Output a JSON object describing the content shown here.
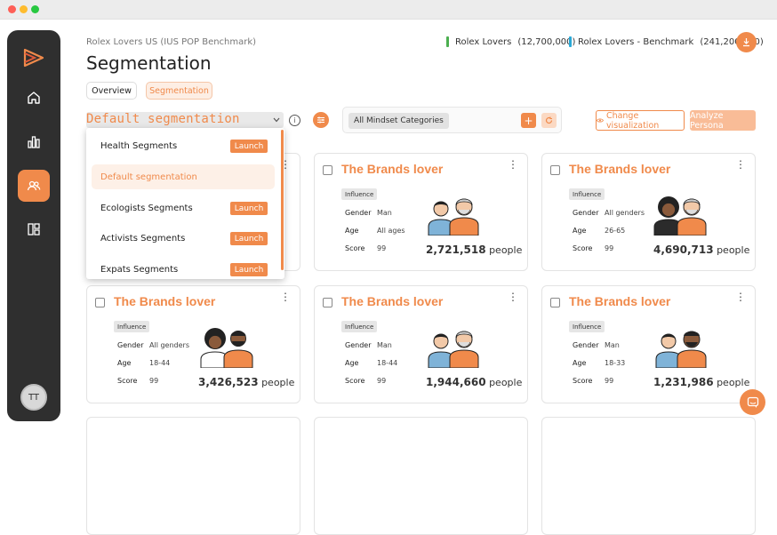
{
  "header": {
    "breadcrumb": "Rolex Lovers US (IUS POP Benchmark)",
    "title": "Segmentation",
    "tabs": [
      {
        "label": "Overview",
        "active": false
      },
      {
        "label": "Segmentation",
        "active": true
      }
    ],
    "legend": [
      {
        "name": "Rolex Lovers",
        "value": "(12,700,000)",
        "color": "#4caf50"
      },
      {
        "name": "Rolex Lovers - Benchmark",
        "value": "(241,200,000)",
        "color": "#29a8d6"
      }
    ]
  },
  "sidebar": {
    "avatar_initials": "TT",
    "items": [
      {
        "icon": "home-icon"
      },
      {
        "icon": "bar-chart-icon"
      },
      {
        "icon": "users-icon",
        "active": true
      },
      {
        "icon": "layout-icon"
      }
    ]
  },
  "toolbar": {
    "segmentation_value": "Default segmentation",
    "mindset_tag": "All Mindset Categories",
    "change_visualization": "Change visualization",
    "analyze_persona": "Analyze Persona"
  },
  "dropdown": {
    "items": [
      {
        "label": "Health Segments",
        "launch": "Launch"
      },
      {
        "label": "Default segmentation",
        "selected": true
      },
      {
        "label": "Ecologists Segments",
        "launch": "Launch"
      },
      {
        "label": "Activists Segments",
        "launch": "Launch"
      },
      {
        "label": "Expats Segments",
        "launch": "Launch"
      }
    ]
  },
  "cards": [
    {
      "title": "The Brands lover",
      "badge": "Influence",
      "gender_label": "Gender",
      "gender": "Man",
      "age_label": "Age",
      "age": "All ages",
      "score_label": "Score",
      "score": "99",
      "count": "2,721,518",
      "unit": "people"
    },
    {
      "title": "The Brands lover",
      "badge": "Influence",
      "gender_label": "Gender",
      "gender": "All genders",
      "age_label": "Age",
      "age": "26-65",
      "score_label": "Score",
      "score": "99",
      "count": "4,690,713",
      "unit": "people"
    },
    {
      "title": "The Brands lover",
      "badge": "Influence",
      "gender_label": "Gender",
      "gender": "All genders",
      "age_label": "Age",
      "age": "18-44",
      "score_label": "Score",
      "score": "99",
      "count": "3,426,523",
      "unit": "people"
    },
    {
      "title": "The Brands lover",
      "badge": "Influence",
      "gender_label": "Gender",
      "gender": "Man",
      "age_label": "Age",
      "age": "18-44",
      "score_label": "Score",
      "score": "99",
      "count": "1,944,660",
      "unit": "people"
    },
    {
      "title": "The Brands lover",
      "badge": "Influence",
      "gender_label": "Gender",
      "gender": "Man",
      "age_label": "Age",
      "age": "18-33",
      "score_label": "Score",
      "score": "99",
      "count": "1,231,986",
      "unit": "people"
    }
  ],
  "colors": {
    "accent": "#f08a4b",
    "sidebar": "#2f2f2f"
  }
}
